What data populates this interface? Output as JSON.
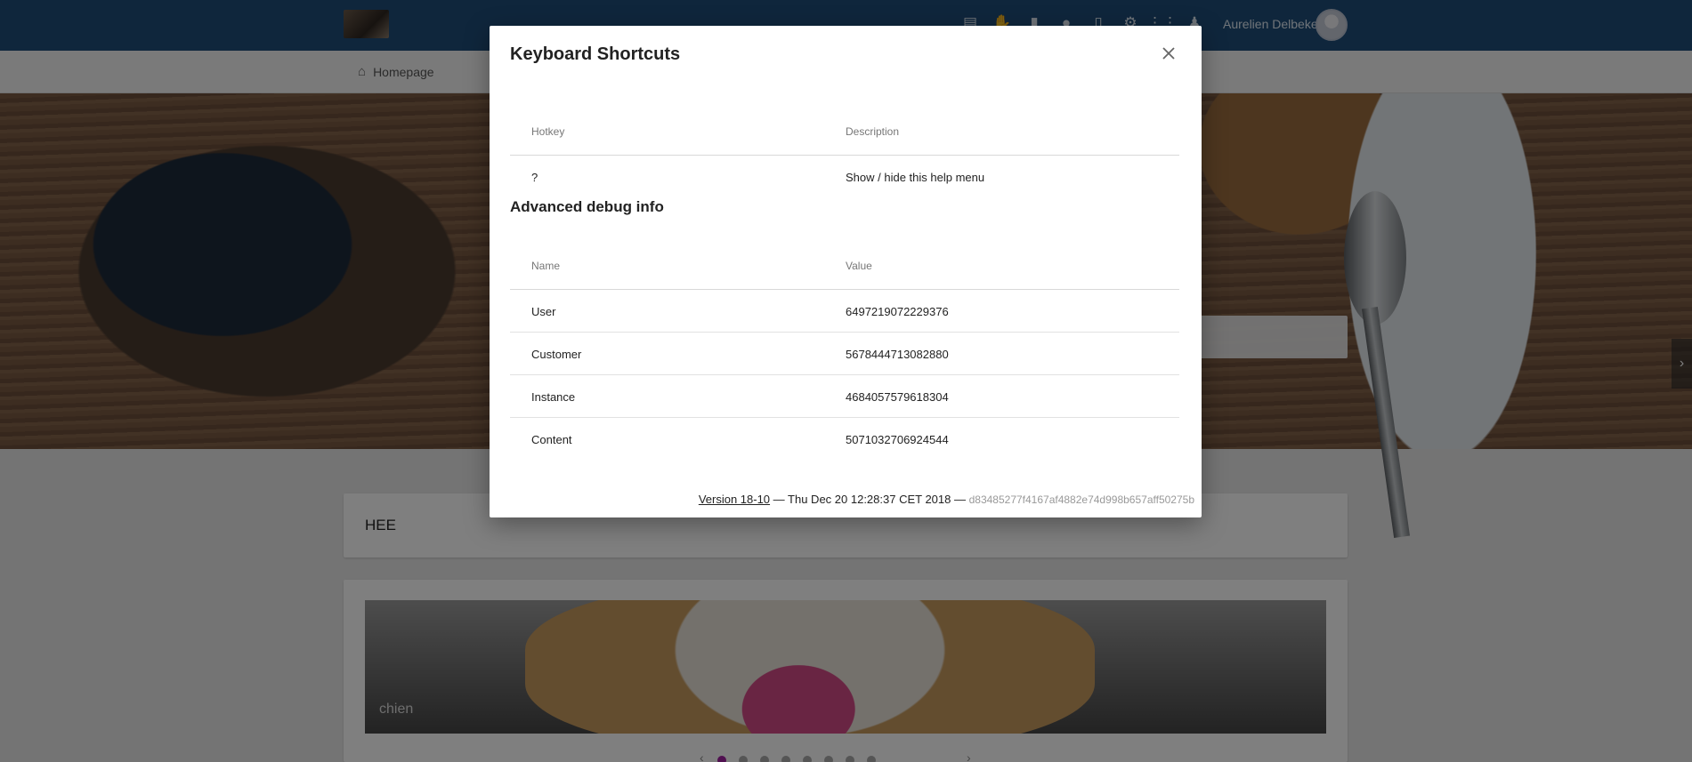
{
  "header": {
    "user_name": "Aurelien Delbeke",
    "icons": [
      "notes-icon",
      "pin-icon",
      "book-icon",
      "place-icon",
      "library-icon",
      "settings-icon",
      "apps-icon",
      "notifications-icon"
    ]
  },
  "nav": {
    "home_label": "Homepage"
  },
  "page": {
    "card_title": "HEE",
    "slide_caption": "chien",
    "carousel_dots": 8,
    "active_dot": 0
  },
  "modal": {
    "title": "Keyboard Shortcuts",
    "shortcuts": {
      "headers": [
        "Hotkey",
        "Description"
      ],
      "rows": [
        {
          "key": "?",
          "description": "Show / hide this help menu"
        }
      ]
    },
    "debug_title": "Advanced debug info",
    "debug": {
      "headers": [
        "Name",
        "Value"
      ],
      "rows": [
        {
          "name": "User",
          "value": "6497219072229376"
        },
        {
          "name": "Customer",
          "value": "5678444713082880"
        },
        {
          "name": "Instance",
          "value": "4684057579618304"
        },
        {
          "name": "Content",
          "value": "5071032706924544"
        }
      ]
    },
    "footer": {
      "version_link": "Version 18-10",
      "sep1": " — ",
      "build_date": "Thu Dec 20 12:28:37 CET 2018",
      "sep2": " — ",
      "hash": "d83485277f4167af4882e74d998b657aff50275b"
    }
  }
}
